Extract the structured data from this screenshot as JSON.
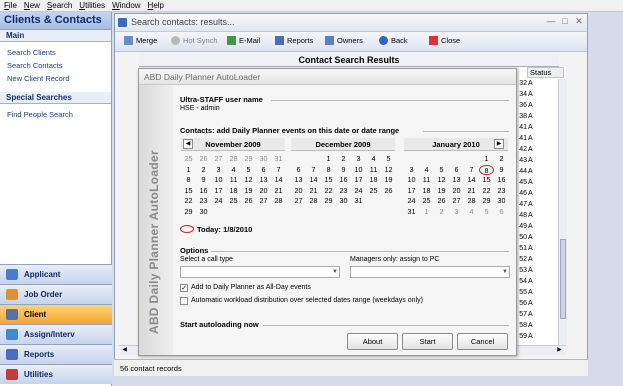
{
  "menu": [
    "File",
    "New",
    "Search",
    "Utilities",
    "Window",
    "Help"
  ],
  "left_panel": {
    "title": "Clients & Contacts",
    "main_section": "Main",
    "main_links": [
      "Search Clients",
      "Search Contacts",
      "New Client Record"
    ],
    "special_section": "Special Searches",
    "special_links": [
      "Find People Search"
    ],
    "nav_buttons": [
      "Applicant",
      "Job Order",
      "Client",
      "Assign/Interv",
      "Reports",
      "Utilities"
    ],
    "active_nav": "Client"
  },
  "window": {
    "title": "Search contacts: results...",
    "toolbar": [
      "Merge",
      "Hot Synch",
      "E-Mail",
      "Reports",
      "Owners",
      "Back",
      "Close"
    ],
    "section_title": "Contact Search Results",
    "status_header": "Status",
    "row_numbers": [
      "32",
      "34",
      "36",
      "38",
      "41",
      "41",
      "42",
      "43",
      "44",
      "45",
      "46",
      "47",
      "48",
      "49",
      "50",
      "51",
      "52",
      "53",
      "54",
      "55",
      "56",
      "57",
      "58",
      "59"
    ],
    "row_status": "A",
    "status_bar": "56 contact records"
  },
  "dialog": {
    "title": "ABD Daily Planner AutoLoader",
    "vertical_title": "ABD Daily Planner AutoLoader",
    "user_heading": "Ultra-STAFF user name",
    "user_value": "HSE - admin",
    "contacts_heading": "Contacts: add Daily Planner events on this date or date range",
    "calendars": [
      {
        "month": "November 2009",
        "weeks": [
          [
            "25",
            "26",
            "27",
            "28",
            "29",
            "30",
            "31"
          ],
          [
            "1",
            "2",
            "3",
            "4",
            "5",
            "6",
            "7"
          ],
          [
            "8",
            "9",
            "10",
            "11",
            "12",
            "13",
            "14"
          ],
          [
            "15",
            "16",
            "17",
            "18",
            "19",
            "20",
            "21"
          ],
          [
            "22",
            "23",
            "24",
            "25",
            "26",
            "27",
            "28"
          ],
          [
            "29",
            "30",
            "",
            "",
            "",
            "",
            ""
          ]
        ]
      },
      {
        "month": "December 2009",
        "weeks": [
          [
            "",
            "",
            "1",
            "2",
            "3",
            "4",
            "5"
          ],
          [
            "6",
            "7",
            "8",
            "9",
            "10",
            "11",
            "12"
          ],
          [
            "13",
            "14",
            "15",
            "16",
            "17",
            "18",
            "19"
          ],
          [
            "20",
            "21",
            "22",
            "23",
            "24",
            "25",
            "26"
          ],
          [
            "27",
            "28",
            "29",
            "30",
            "31",
            "",
            ""
          ],
          [
            "",
            "",
            "",
            "",
            "",
            "",
            ""
          ]
        ]
      },
      {
        "month": "January 2010",
        "weeks": [
          [
            "",
            "",
            "",
            "",
            "",
            "1",
            "2"
          ],
          [
            "3",
            "4",
            "5",
            "6",
            "7",
            "8",
            "9"
          ],
          [
            "10",
            "11",
            "12",
            "13",
            "14",
            "15",
            "16"
          ],
          [
            "17",
            "18",
            "19",
            "20",
            "21",
            "22",
            "23"
          ],
          [
            "24",
            "25",
            "26",
            "27",
            "28",
            "29",
            "30"
          ],
          [
            "31",
            "1",
            "2",
            "3",
            "4",
            "5",
            "6"
          ]
        ]
      }
    ],
    "today_label": "Today: 1/8/2010",
    "options_heading": "Options",
    "call_type_label": "Select a call type",
    "managers_label": "Managers only: assign to PC",
    "checkbox_allday": "Add to Daily Planner as All-Day events",
    "checkbox_allday_checked": true,
    "checkbox_workload": "Automatic workload distribution over selected dates range (weekdays only)",
    "checkbox_workload_checked": false,
    "start_heading": "Start autoloading now",
    "buttons": [
      "About",
      "Start",
      "Cancel"
    ]
  },
  "colors": {
    "accent_active_nav": "#f5a62e",
    "circle_mark": "#d02020",
    "left_header": "#0d2a6b"
  }
}
